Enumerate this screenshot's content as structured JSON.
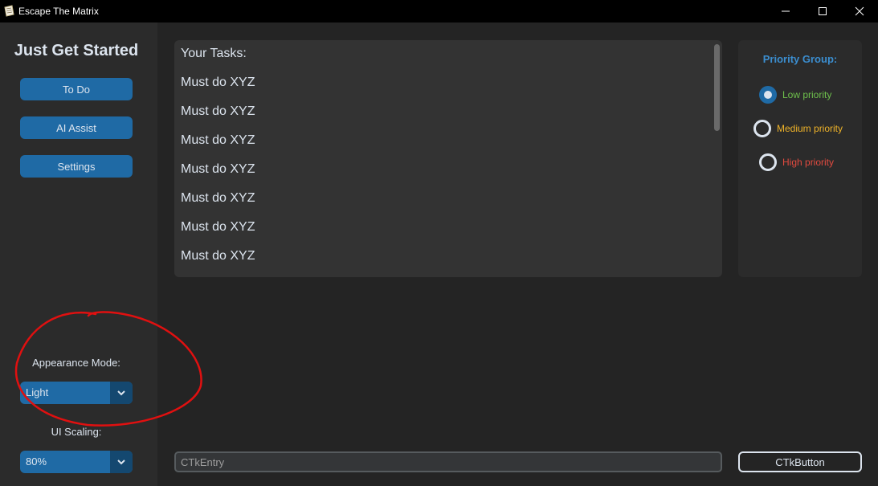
{
  "window": {
    "title": "Escape The Matrix"
  },
  "sidebar": {
    "logo": "Just Get Started",
    "buttons": [
      {
        "label": "To Do"
      },
      {
        "label": "AI Assist"
      },
      {
        "label": "Settings"
      }
    ],
    "appearance_label": "Appearance Mode:",
    "appearance_value": "Light",
    "scaling_label": "UI Scaling:",
    "scaling_value": "80%"
  },
  "tasks": {
    "header": "Your Tasks:",
    "items": [
      "Must do XYZ",
      "Must do XYZ",
      "Must do XYZ",
      "Must do XYZ",
      "Must do XYZ",
      "Must do XYZ",
      "Must do XYZ"
    ]
  },
  "priority": {
    "title": "Priority Group:",
    "options": [
      {
        "label": "Low priority",
        "checked": true,
        "color": "#6ec04c"
      },
      {
        "label": "Medium priority",
        "checked": false,
        "color": "#f0b429"
      },
      {
        "label": "High priority",
        "checked": false,
        "color": "#e04a3f"
      }
    ]
  },
  "entry": {
    "placeholder": "CTkEntry"
  },
  "action_button": {
    "label": "CTkButton"
  },
  "colors": {
    "accent": "#1f6aa5",
    "accent_dark": "#144870",
    "annotation": "#e01010",
    "background": "#242424",
    "frame": "#2b2b2b"
  }
}
